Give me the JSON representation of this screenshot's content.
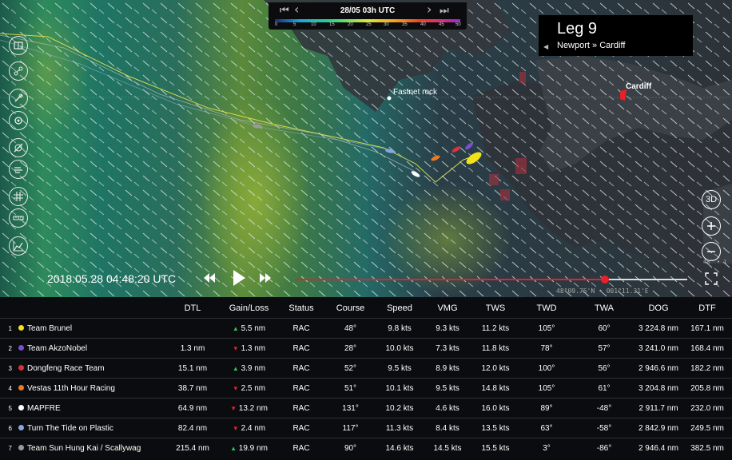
{
  "header": {
    "date": "28/05 03h UTC",
    "nav_first": "⏮",
    "nav_prev": "‹",
    "nav_next": "›",
    "nav_last": "⏭",
    "wind_scale": [
      "0",
      "5",
      "10",
      "15",
      "20",
      "25",
      "30",
      "35",
      "40",
      "45",
      "50"
    ]
  },
  "leg": {
    "title": "Leg 9",
    "route": "Newport » Cardiff"
  },
  "map": {
    "places": {
      "fastnet": "Fastnet rock",
      "cardiff": "Cardiff"
    },
    "coords": "48°09.75'N • 001°11.31'E",
    "edge_coords": "48° • 1",
    "left_tools": [
      "book-icon",
      "route-icon",
      "link-icon",
      "compass-icon",
      "no-compass-icon",
      "wind-layer-icon",
      "grid-icon",
      "ruler-icon",
      "chart-icon"
    ],
    "right_tools": {
      "three_d": "3D",
      "zoom_in": "zoom-in-icon",
      "zoom_out": "zoom-out-icon",
      "fullscreen": "fullscreen-icon"
    }
  },
  "player": {
    "time": "2018.05.28 04:48:20 UTC",
    "progress": 0.79
  },
  "table": {
    "columns": [
      "DTL",
      "Gain/Loss",
      "Status",
      "Course",
      "Speed",
      "VMG",
      "TWS",
      "TWD",
      "TWA",
      "DOG",
      "DTF"
    ],
    "rows": [
      {
        "rank": "1",
        "color": "#f2e21a",
        "team": "Team Brunel",
        "dtl": "",
        "gain_dir": "up",
        "gain": "5.5 nm",
        "status": "RAC",
        "course": "48°",
        "speed": "9.8 kts",
        "vmg": "9.3 kts",
        "tws": "11.2 kts",
        "twd": "105°",
        "twa": "60°",
        "dog": "3 224.8 nm",
        "dtf": "167.1 nm"
      },
      {
        "rank": "2",
        "color": "#7a4fd0",
        "team": "Team AkzoNobel",
        "dtl": "1.3 nm",
        "gain_dir": "down",
        "gain": "1.3 nm",
        "status": "RAC",
        "course": "28°",
        "speed": "10.0 kts",
        "vmg": "7.3 kts",
        "tws": "11.8 kts",
        "twd": "78°",
        "twa": "57°",
        "dog": "3 241.0 nm",
        "dtf": "168.4 nm"
      },
      {
        "rank": "3",
        "color": "#d8323a",
        "team": "Dongfeng Race Team",
        "dtl": "15.1 nm",
        "gain_dir": "up",
        "gain": "3.9 nm",
        "status": "RAC",
        "course": "52°",
        "speed": "9.5 kts",
        "vmg": "8.9 kts",
        "tws": "12.0 kts",
        "twd": "100°",
        "twa": "56°",
        "dog": "2 946.6 nm",
        "dtf": "182.2 nm"
      },
      {
        "rank": "4",
        "color": "#ee7a1e",
        "team": "Vestas 11th Hour Racing",
        "dtl": "38.7 nm",
        "gain_dir": "down",
        "gain": "2.5 nm",
        "status": "RAC",
        "course": "51°",
        "speed": "10.1 kts",
        "vmg": "9.5 kts",
        "tws": "14.8 kts",
        "twd": "105°",
        "twa": "61°",
        "dog": "3 204.8 nm",
        "dtf": "205.8 nm"
      },
      {
        "rank": "5",
        "color": "#ffffff",
        "team": "MAPFRE",
        "dtl": "64.9 nm",
        "gain_dir": "down",
        "gain": "13.2 nm",
        "status": "RAC",
        "course": "131°",
        "speed": "10.2 kts",
        "vmg": "4.6 kts",
        "tws": "16.0 kts",
        "twd": "89°",
        "twa": "-48°",
        "dog": "2 911.7 nm",
        "dtf": "232.0 nm"
      },
      {
        "rank": "6",
        "color": "#8aa6e0",
        "team": "Turn The Tide on Plastic",
        "dtl": "82.4 nm",
        "gain_dir": "down",
        "gain": "2.4 nm",
        "status": "RAC",
        "course": "117°",
        "speed": "11.3 kts",
        "vmg": "8.4 kts",
        "tws": "13.5 kts",
        "twd": "63°",
        "twa": "-58°",
        "dog": "2 842.9 nm",
        "dtf": "249.5 nm"
      },
      {
        "rank": "7",
        "color": "#9a9a9a",
        "team": "Team Sun Hung Kai / Scallywag",
        "dtl": "215.4 nm",
        "gain_dir": "up",
        "gain": "19.9 nm",
        "status": "RAC",
        "course": "90°",
        "speed": "14.6 kts",
        "vmg": "14.5 kts",
        "tws": "15.5 kts",
        "twd": "3°",
        "twa": "-86°",
        "dog": "2 946.4 nm",
        "dtf": "382.5 nm"
      }
    ]
  }
}
